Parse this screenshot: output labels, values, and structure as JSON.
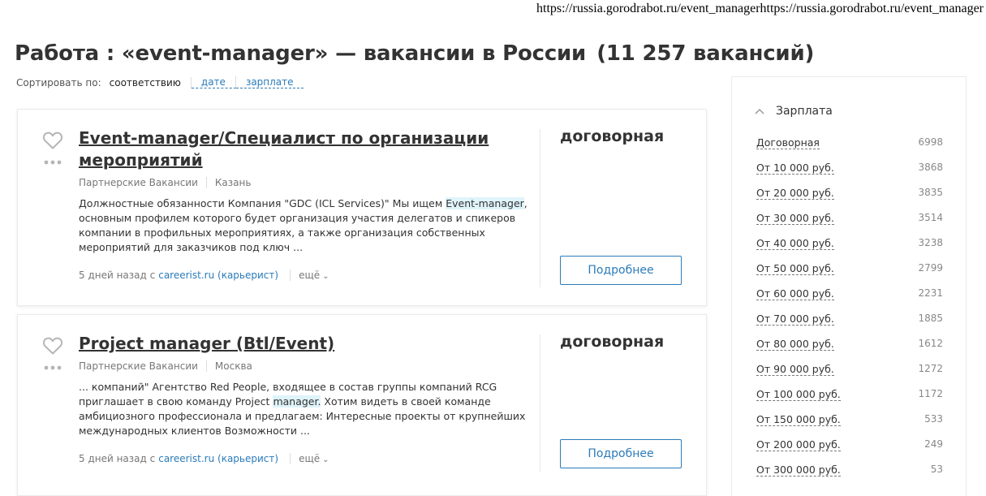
{
  "url_line": "https://russia.gorodrabot.ru/event_managerhttps://russia.gorodrabot.ru/event_manager",
  "page": {
    "title": "Работа : «event-manager» — вакансии в России",
    "count": "(11 257 вакансий)"
  },
  "sort": {
    "label": "Сортировать по:",
    "current": "соответствию",
    "options": [
      "дате",
      "зарплате"
    ]
  },
  "vacancies": [
    {
      "title": "Event-manager/Специалист по организации мероприятий",
      "company": "Партнерские Вакансии",
      "city": "Казань",
      "desc_before": "Должностные обязанности Компания \"GDC (ICL Services)\" Мы ищем ",
      "desc_highlight": "Event-manager",
      "desc_after": ", основным профилем которого будет организация участия делегатов и спикеров компании в профильных мероприятиях, а также организация собственных мероприятий для заказчиков под ключ ...",
      "posted": "5 дней назад с",
      "source": "careerist.ru (карьерист)",
      "more": "ещё",
      "salary": "договорная",
      "button": "Подробнее"
    },
    {
      "title": "Project manager (Btl/Event)",
      "company": "Партнерские Вакансии",
      "city": "Москва",
      "desc_before": "... компаний\" Агентство Red People, входящее в состав группы компаний RCG приглашает в свою команду Project ",
      "desc_highlight": "manager.",
      "desc_after": " Хотим видеть в своей команде амбициозного профессионала и предлагаем: Интересные проекты от крупнейших международных клиентов Возможности ...",
      "posted": "5 дней назад с",
      "source": "careerist.ru (карьерист)",
      "more": "ещё",
      "salary": "договорная",
      "button": "Подробнее"
    }
  ],
  "filter": {
    "heading": "Зарплата",
    "items": [
      {
        "label": "Договорная",
        "count": "6998"
      },
      {
        "label": "От 10 000 руб.",
        "count": "3868"
      },
      {
        "label": "От 20 000 руб.",
        "count": "3835"
      },
      {
        "label": "От 30 000 руб.",
        "count": "3514"
      },
      {
        "label": "От 40 000 руб.",
        "count": "3238"
      },
      {
        "label": "От 50 000 руб.",
        "count": "2799"
      },
      {
        "label": "От 60 000 руб.",
        "count": "2231"
      },
      {
        "label": "От 70 000 руб.",
        "count": "1885"
      },
      {
        "label": "От 80 000 руб.",
        "count": "1612"
      },
      {
        "label": "От 90 000 руб.",
        "count": "1272"
      },
      {
        "label": "От 100 000 руб.",
        "count": "1172"
      },
      {
        "label": "От 150 000 руб.",
        "count": "533"
      },
      {
        "label": "От 200 000 руб.",
        "count": "249"
      },
      {
        "label": "От 300 000 руб.",
        "count": "53"
      }
    ]
  },
  "colors": {
    "link": "#2b7bb9",
    "highlight": "#dff3fa",
    "text": "#333333",
    "muted": "#777777"
  },
  "icons": [
    "heart-icon",
    "more-dots-icon",
    "chevron-down-icon",
    "chevron-up-icon"
  ]
}
